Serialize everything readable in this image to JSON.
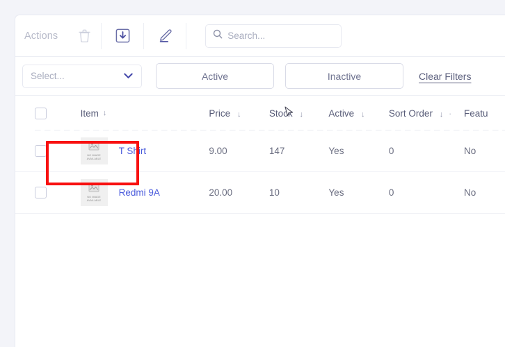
{
  "theme": {
    "page_bg": "#f3f4f9",
    "card_bg": "#ffffff",
    "link_color": "#4a5bdc",
    "annotation_color": "#f81010",
    "muted_text": "#a9adbf"
  },
  "toolbar": {
    "actions_label": "Actions",
    "delete_icon": "trash-icon",
    "import_icon": "download-box-icon",
    "edit_icon": "pencil-icon"
  },
  "search": {
    "icon": "search-icon",
    "placeholder": "Search...",
    "value": ""
  },
  "filters": {
    "select_placeholder": "Select...",
    "select_chevron": "chevron-down-icon",
    "active_label": "Active",
    "inactive_label": "Inactive",
    "clear_label": "Clear Filters"
  },
  "table": {
    "columns": [
      {
        "label": "Item",
        "sort": "↓"
      },
      {
        "label": "Price",
        "sort": "↓"
      },
      {
        "label": "Stock",
        "sort": "↓"
      },
      {
        "label": "Active",
        "sort": "↓"
      },
      {
        "label": "Sort Order",
        "sort": "↓",
        "separator": "·"
      },
      {
        "label": "Featu",
        "sort": ""
      }
    ],
    "thumb_placeholder_line1": "NO IMAGE",
    "thumb_placeholder_line2": "AVAILABLE",
    "rows": [
      {
        "item": "T Shirt",
        "price": "9.00",
        "stock": "147",
        "active": "Yes",
        "sort_order": "0",
        "featured": "No",
        "thumbnail": "no-image-available",
        "highlighted": true
      },
      {
        "item": "Redmi 9A",
        "price": "20.00",
        "stock": "10",
        "active": "Yes",
        "sort_order": "0",
        "featured": "No",
        "thumbnail": "no-image-available",
        "highlighted": false
      }
    ]
  },
  "annotation": {
    "target": "T Shirt",
    "shape": "red-rectangle"
  },
  "cursor": {
    "icon": "mouse-pointer",
    "over": "Stock"
  }
}
